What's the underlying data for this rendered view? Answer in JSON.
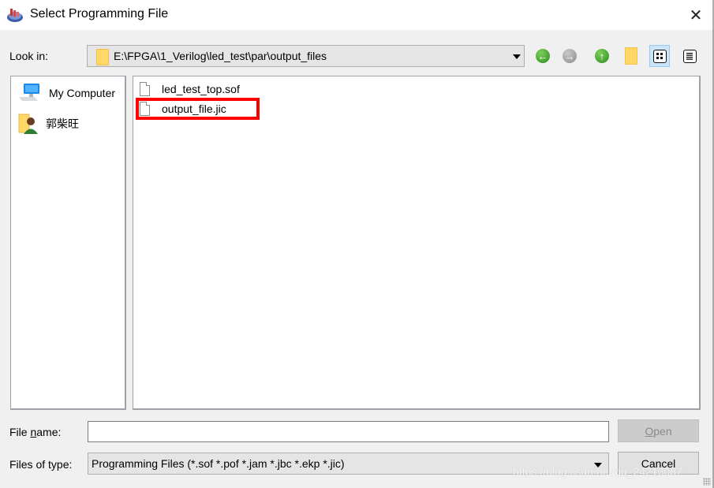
{
  "window": {
    "title": "Select Programming File",
    "close_icon": "close-icon"
  },
  "toolbar": {
    "look_in_label": "Look in:",
    "look_in_path": "E:\\FPGA\\1_Verilog\\led_test\\par\\output_files",
    "buttons": [
      {
        "name": "back",
        "icon": "arrow-left-icon",
        "enabled": true
      },
      {
        "name": "forward",
        "icon": "arrow-right-icon",
        "enabled": false
      },
      {
        "name": "parent-directory",
        "icon": "arrow-up-icon",
        "enabled": true
      },
      {
        "name": "create-new-folder",
        "icon": "new-folder-icon",
        "enabled": true
      },
      {
        "name": "list-view",
        "icon": "list-view-icon",
        "selected": true
      },
      {
        "name": "detail-view",
        "icon": "detail-view-icon",
        "selected": false
      }
    ]
  },
  "sidebar": {
    "items": [
      {
        "label": "My Computer",
        "icon": "computer-icon"
      },
      {
        "label": "郭柴旺",
        "icon": "user-folder-icon"
      }
    ]
  },
  "files": [
    {
      "name": "led_test_top.sof",
      "highlighted": false
    },
    {
      "name": "output_file.jic",
      "highlighted": true
    }
  ],
  "highlight_color": "#ff0000",
  "footer": {
    "file_name_label_pre": "File ",
    "file_name_label_mnemonic": "n",
    "file_name_label_post": "ame:",
    "file_name_value": "",
    "files_of_type_label": "Files of type:",
    "files_of_type_value": "Programming Files (*.sof *.pof *.jam *.jbc *.ekp *.jic)",
    "open_label_mnemonic": "O",
    "open_label_rest": "pen",
    "open_enabled": false,
    "cancel_label": "Cancel"
  },
  "watermark": "https://blog.csdn.net/qq_24213087"
}
